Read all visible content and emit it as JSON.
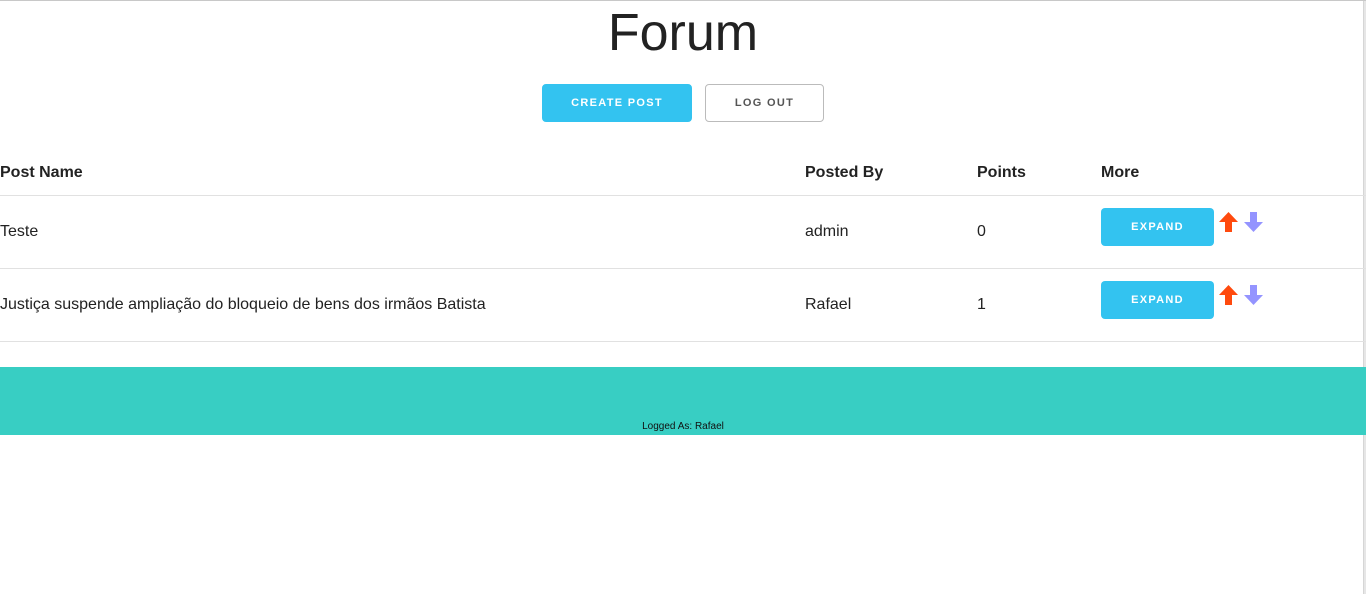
{
  "page": {
    "title": "Forum"
  },
  "actions": {
    "create_post_label": "CREATE POST",
    "log_out_label": "LOG OUT"
  },
  "table": {
    "headers": {
      "name": "Post Name",
      "by": "Posted By",
      "points": "Points",
      "more": "More"
    },
    "rows": [
      {
        "name": "Teste",
        "by": "admin",
        "points": "0",
        "expand_label": "EXPAND"
      },
      {
        "name": "Justiça suspende ampliação do bloqueio de bens dos irmãos Batista",
        "by": "Rafael",
        "points": "1",
        "expand_label": "EXPAND"
      }
    ]
  },
  "footer": {
    "logged_as": "Logged As: Rafael"
  },
  "colors": {
    "primary": "#33c3f0",
    "footer": "#38cec3",
    "upvote": "#ff4a0e",
    "downvote": "#9494ff"
  },
  "icons": {
    "upvote": "arrow-up-icon",
    "downvote": "arrow-down-icon"
  }
}
